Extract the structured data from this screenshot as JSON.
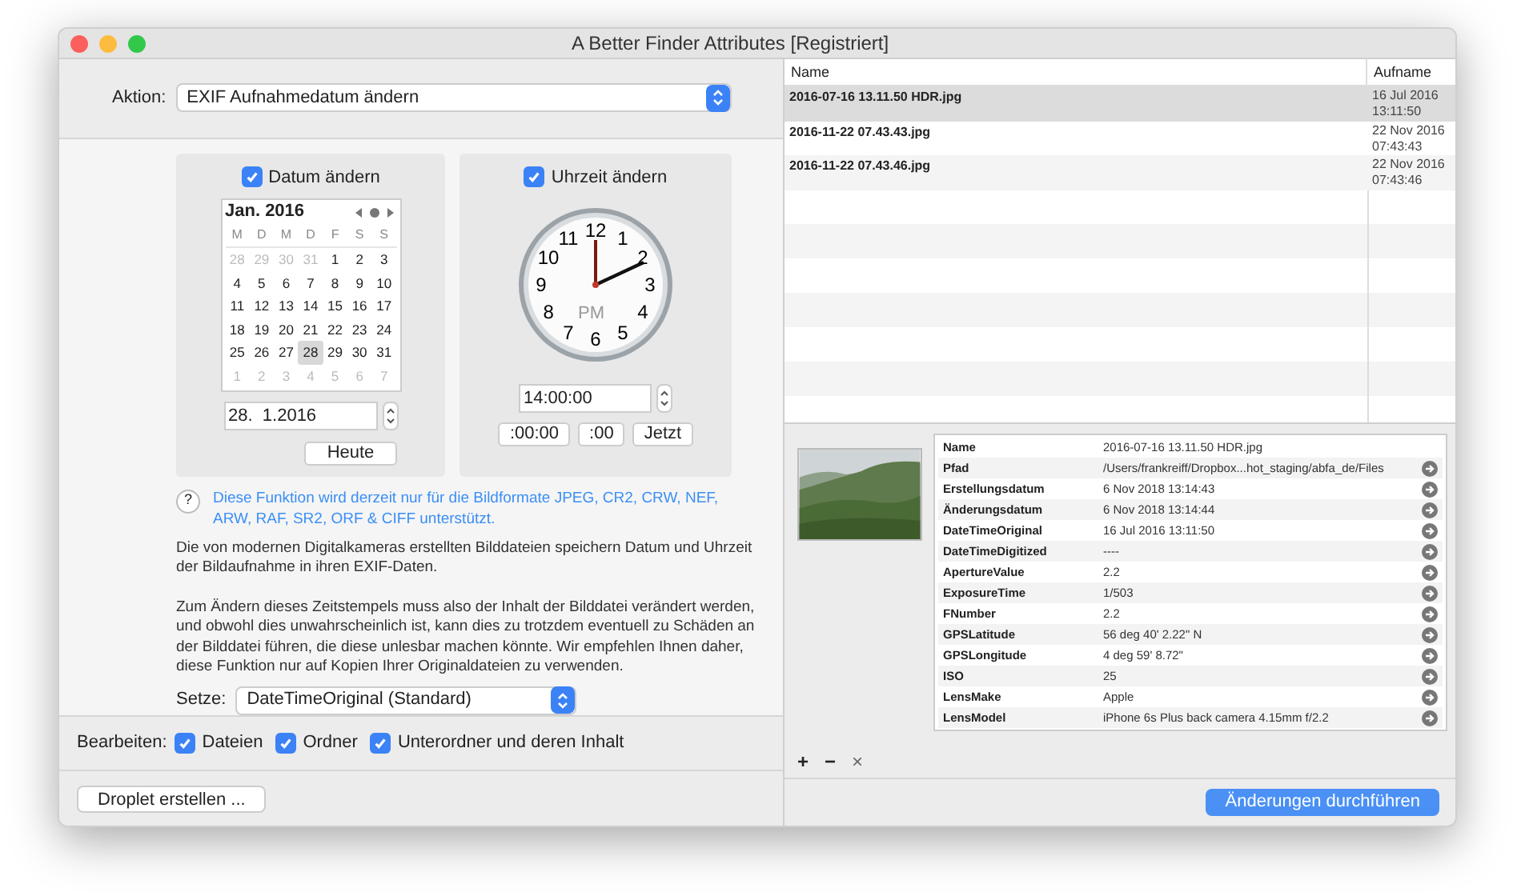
{
  "window": {
    "title": "A Better Finder Attributes [Registriert]"
  },
  "action": {
    "label": "Aktion:",
    "value": "EXIF Aufnahmedatum ändern"
  },
  "date_panel": {
    "label": "Datum ändern",
    "checked": true,
    "month": "Jan. 2016",
    "weekdays": [
      "M",
      "D",
      "M",
      "D",
      "F",
      "S",
      "S"
    ],
    "days": [
      {
        "label": "28",
        "outside": true,
        "selected": false
      },
      {
        "label": "29",
        "outside": true,
        "selected": false
      },
      {
        "label": "30",
        "outside": true,
        "selected": false
      },
      {
        "label": "31",
        "outside": true,
        "selected": false
      },
      {
        "label": "1",
        "outside": false,
        "selected": false
      },
      {
        "label": "2",
        "outside": false,
        "selected": false
      },
      {
        "label": "3",
        "outside": false,
        "selected": false
      },
      {
        "label": "4",
        "outside": false,
        "selected": false
      },
      {
        "label": "5",
        "outside": false,
        "selected": false
      },
      {
        "label": "6",
        "outside": false,
        "selected": false
      },
      {
        "label": "7",
        "outside": false,
        "selected": false
      },
      {
        "label": "8",
        "outside": false,
        "selected": false
      },
      {
        "label": "9",
        "outside": false,
        "selected": false
      },
      {
        "label": "10",
        "outside": false,
        "selected": false
      },
      {
        "label": "11",
        "outside": false,
        "selected": false
      },
      {
        "label": "12",
        "outside": false,
        "selected": false
      },
      {
        "label": "13",
        "outside": false,
        "selected": false
      },
      {
        "label": "14",
        "outside": false,
        "selected": false
      },
      {
        "label": "15",
        "outside": false,
        "selected": false
      },
      {
        "label": "16",
        "outside": false,
        "selected": false
      },
      {
        "label": "17",
        "outside": false,
        "selected": false
      },
      {
        "label": "18",
        "outside": false,
        "selected": false
      },
      {
        "label": "19",
        "outside": false,
        "selected": false
      },
      {
        "label": "20",
        "outside": false,
        "selected": false
      },
      {
        "label": "21",
        "outside": false,
        "selected": false
      },
      {
        "label": "22",
        "outside": false,
        "selected": false
      },
      {
        "label": "23",
        "outside": false,
        "selected": false
      },
      {
        "label": "24",
        "outside": false,
        "selected": false
      },
      {
        "label": "25",
        "outside": false,
        "selected": false
      },
      {
        "label": "26",
        "outside": false,
        "selected": false
      },
      {
        "label": "27",
        "outside": false,
        "selected": false
      },
      {
        "label": "28",
        "outside": false,
        "selected": true
      },
      {
        "label": "29",
        "outside": false,
        "selected": false
      },
      {
        "label": "30",
        "outside": false,
        "selected": false
      },
      {
        "label": "31",
        "outside": false,
        "selected": false
      },
      {
        "label": "1",
        "outside": true,
        "selected": false
      },
      {
        "label": "2",
        "outside": true,
        "selected": false
      },
      {
        "label": "3",
        "outside": true,
        "selected": false
      },
      {
        "label": "4",
        "outside": true,
        "selected": false
      },
      {
        "label": "5",
        "outside": true,
        "selected": false
      },
      {
        "label": "6",
        "outside": true,
        "selected": false
      },
      {
        "label": "7",
        "outside": true,
        "selected": false
      }
    ],
    "value": "28.  1.2016",
    "today_button": "Heute"
  },
  "time_panel": {
    "label": "Uhrzeit ändern",
    "checked": true,
    "clock_numbers": [
      "12",
      "11",
      "1",
      "10",
      "2",
      "9",
      "3",
      "8",
      "4",
      "7",
      "5",
      "6"
    ],
    "meridiem": "PM",
    "value": "14:00:00",
    "buttons": [
      ":00:00",
      ":00",
      "Jetzt"
    ]
  },
  "help": {
    "icon": "?",
    "text": "Diese Funktion wird derzeit nur für die Bildformate JPEG, CR2, CRW, NEF, ARW, RAF, SR2, ORF & CIFF unterstützt."
  },
  "description": [
    "Die von modernen Digitalkameras erstellten Bilddateien speichern Datum und Uhrzeit der Bildaufnahme in ihren EXIF-Daten.",
    "Zum Ändern dieses Zeitstempels muss also der Inhalt der Bilddatei verändert werden, und obwohl dies unwahrscheinlich ist, kann dies zu trotzdem eventuell zu Schäden an der Bilddatei führen, die diese unlesbar machen könnte. Wir empfehlen Ihnen daher, diese Funktion nur auf Kopien Ihrer Originaldateien zu verwenden."
  ],
  "set": {
    "label": "Setze:",
    "value": "DateTimeOriginal (Standard)"
  },
  "edit": {
    "label": "Bearbeiten:",
    "options": [
      {
        "label": "Dateien",
        "checked": true
      },
      {
        "label": "Ordner",
        "checked": true
      },
      {
        "label": "Unterordner und deren Inhalt",
        "checked": true
      }
    ]
  },
  "droplet_button": "Droplet erstellen ...",
  "files": {
    "columns": [
      "Name",
      "Aufname"
    ],
    "rows": [
      {
        "name": "2016-07-16 13.11.50 HDR.jpg",
        "date": "16 Jul 2016",
        "time": "13:11:50",
        "selected": true
      },
      {
        "name": "2016-11-22 07.43.43.jpg",
        "date": "22 Nov 2016",
        "time": "07:43:43",
        "selected": false
      },
      {
        "name": "2016-11-22 07.43.46.jpg",
        "date": "22 Nov 2016",
        "time": "07:43:46",
        "selected": false
      }
    ]
  },
  "info": [
    {
      "label": "Name",
      "value": "2016-07-16 13.11.50 HDR.jpg",
      "arrow": false
    },
    {
      "label": "Pfad",
      "value": "/Users/frankreiff/Dropbox...hot_staging/abfa_de/Files",
      "arrow": true
    },
    {
      "label": "Erstellungsdatum",
      "value": "6 Nov 2018 13:14:43",
      "arrow": true
    },
    {
      "label": "Änderungsdatum",
      "value": "6 Nov 2018 13:14:44",
      "arrow": true
    },
    {
      "label": "DateTimeOriginal",
      "value": "16 Jul 2016 13:11:50",
      "arrow": true
    },
    {
      "label": "DateTimeDigitized",
      "value": "----",
      "arrow": true
    },
    {
      "label": "ApertureValue",
      "value": "2.2",
      "arrow": true
    },
    {
      "label": "ExposureTime",
      "value": "1/503",
      "arrow": true
    },
    {
      "label": "FNumber",
      "value": "2.2",
      "arrow": true
    },
    {
      "label": "GPSLatitude",
      "value": "56 deg 40' 2.22\" N",
      "arrow": true
    },
    {
      "label": "GPSLongitude",
      "value": "4 deg 59' 8.72\"",
      "arrow": true
    },
    {
      "label": "ISO",
      "value": "25",
      "arrow": true
    },
    {
      "label": "LensMake",
      "value": "Apple",
      "arrow": true
    },
    {
      "label": "LensModel",
      "value": "iPhone 6s Plus back camera 4.15mm f/2.2",
      "arrow": true
    }
  ],
  "list_tools": [
    "+",
    "−",
    "×"
  ],
  "apply_button": "Änderungen durchführen"
}
